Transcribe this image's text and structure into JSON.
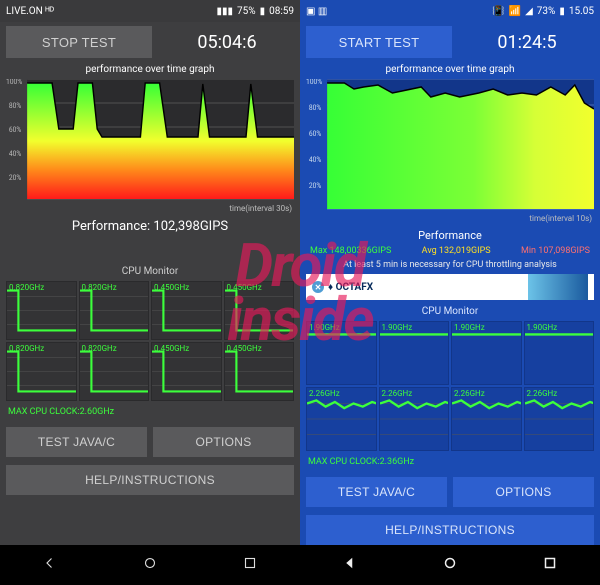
{
  "left": {
    "status": {
      "carrier": "LIVE.ON ᴴᴰ",
      "battery": "75%",
      "time": "08:59"
    },
    "stop_label": "STOP TEST",
    "timer": "05:04:6",
    "graph_title": "performance over time graph",
    "axis_interval": "time(interval 30s)",
    "performance_label": "Performance: 102,398GIPS",
    "cpu_title": "CPU Monitor",
    "cpu_freqs": [
      "0.820GHz",
      "0.820GHz",
      "0.450GHz",
      "0.450GHz",
      "0.820GHz",
      "0.820GHz",
      "0.450GHz",
      "0.450GHz"
    ],
    "max_clock": "MAX CPU CLOCK:2.60GHz",
    "btn_test": "TEST JAVA/C",
    "btn_options": "OPTIONS",
    "btn_help": "HELP/INSTRUCTIONS"
  },
  "right": {
    "status": {
      "battery": "73%",
      "time": "15.05"
    },
    "start_label": "START TEST",
    "timer": "01:24:5",
    "graph_title": "performance over time graph",
    "axis_interval": "time(interval 10s)",
    "perf_heading": "Performance",
    "max": "Max 148,00336GIPS",
    "avg": "Avg 132,019GIPS",
    "min": "Min 107,098GIPS",
    "note": "At least 5 min is necessary for CPU throttling analysis",
    "ad_brand": "♦ OCTAFX",
    "cpu_title": "CPU Monitor",
    "cpu_freqs": [
      "1.90GHz",
      "1.90GHz",
      "1.90GHz",
      "1.90GHz",
      "2.26GHz",
      "2.26GHz",
      "2.26GHz",
      "2.26GHz"
    ],
    "max_clock": "MAX CPU CLOCK:2.36GHz",
    "btn_test": "TEST JAVA/C",
    "btn_options": "OPTIONS",
    "btn_help": "HELP/INSTRUCTIONS"
  },
  "watermark": {
    "line1": "Droid",
    "line2": "inside"
  },
  "chart_data": [
    {
      "type": "area",
      "title": "performance over time graph (left)",
      "ylabel": "%",
      "ylim": [
        0,
        100
      ],
      "x_unit": "interval 30s",
      "x": [
        0,
        1,
        2,
        3,
        4,
        5,
        6,
        7,
        8,
        9,
        10,
        11,
        12,
        13,
        14,
        15,
        16,
        17,
        18,
        19
      ],
      "values": [
        98,
        98,
        60,
        60,
        98,
        60,
        55,
        55,
        55,
        98,
        98,
        55,
        55,
        55,
        98,
        55,
        55,
        55,
        98,
        55
      ],
      "fill_gradient": [
        "#36ff36",
        "#f2ff2d",
        "#ff8a1a",
        "#ff1a1a"
      ]
    },
    {
      "type": "area",
      "title": "performance over time graph (right)",
      "ylabel": "%",
      "ylim": [
        0,
        100
      ],
      "x_unit": "interval 10s",
      "x": [
        0,
        1,
        2,
        3,
        4,
        5,
        6,
        7,
        8,
        9,
        10,
        11,
        12,
        13,
        14,
        15,
        16,
        17,
        18,
        19
      ],
      "values": [
        98,
        98,
        95,
        92,
        96,
        90,
        90,
        94,
        95,
        87,
        90,
        92,
        90,
        95,
        90,
        92,
        90,
        96,
        90,
        80
      ],
      "fill_gradient": [
        "#36ff36",
        "#d6ff36",
        "#f2ff2d"
      ]
    }
  ]
}
